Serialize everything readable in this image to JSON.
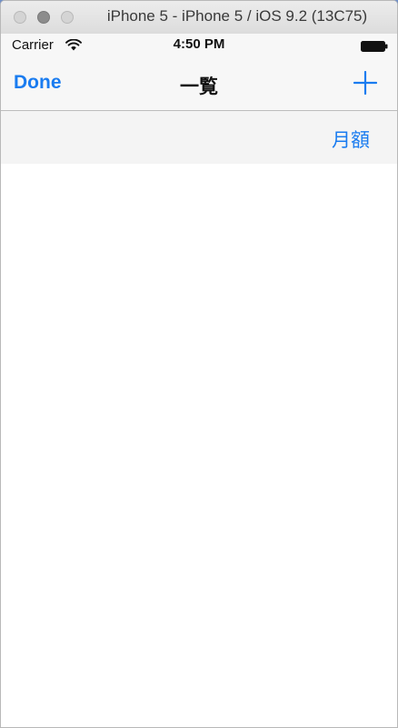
{
  "window": {
    "title": "iPhone 5 - iPhone 5 / iOS 9.2 (13C75)"
  },
  "status_bar": {
    "carrier": "Carrier",
    "time": "4:50 PM",
    "icons": [
      "wifi-icon",
      "battery-icon"
    ]
  },
  "nav_bar": {
    "done_label": "Done",
    "title": "一覧",
    "add_icon": "plus-icon"
  },
  "header": {
    "monthly_label": "月額"
  },
  "colors": {
    "accent": "#1a7cf0",
    "bar_background": "#f7f7f7"
  }
}
